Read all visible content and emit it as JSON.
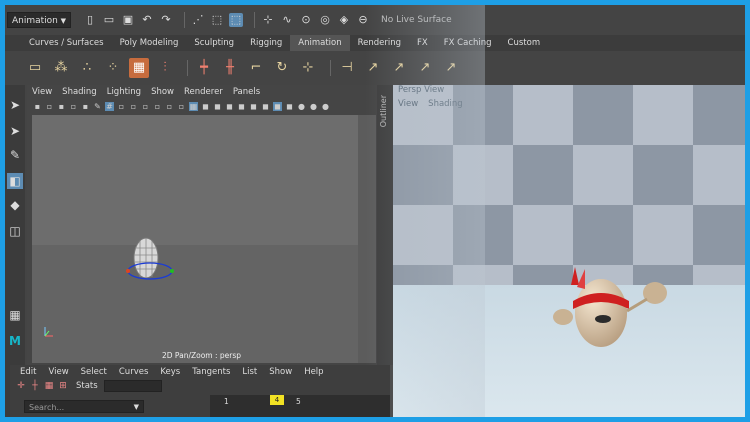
{
  "statusline": {
    "menu_set": "Animation",
    "live_surface": "No Live Surface"
  },
  "shelf_tabs": [
    "Curves / Surfaces",
    "Poly Modeling",
    "Sculpting",
    "Rigging",
    "Animation",
    "Rendering",
    "FX",
    "FX Caching",
    "Custom"
  ],
  "active_shelf_tab": "Animation",
  "viewport": {
    "menu": [
      "View",
      "Shading",
      "Lighting",
      "Show",
      "Renderer",
      "Panels"
    ],
    "camera_label": "2D Pan/Zoom : persp"
  },
  "outliner": {
    "label": "Outliner"
  },
  "persp": {
    "title": "Persp View",
    "menu": [
      "View",
      "Shading"
    ]
  },
  "graph_editor": {
    "menu": [
      "Edit",
      "View",
      "Select",
      "Curves",
      "Keys",
      "Tangents",
      "List",
      "Show",
      "Help"
    ],
    "stats_label": "Stats",
    "search_placeholder": "Search...",
    "frame_ticks": [
      "1",
      "4",
      "5"
    ],
    "current_frame": "4"
  },
  "colors": {
    "accent": "#1e9fe6",
    "highlight": "#5d8cb3",
    "marker": "#f2e224"
  }
}
